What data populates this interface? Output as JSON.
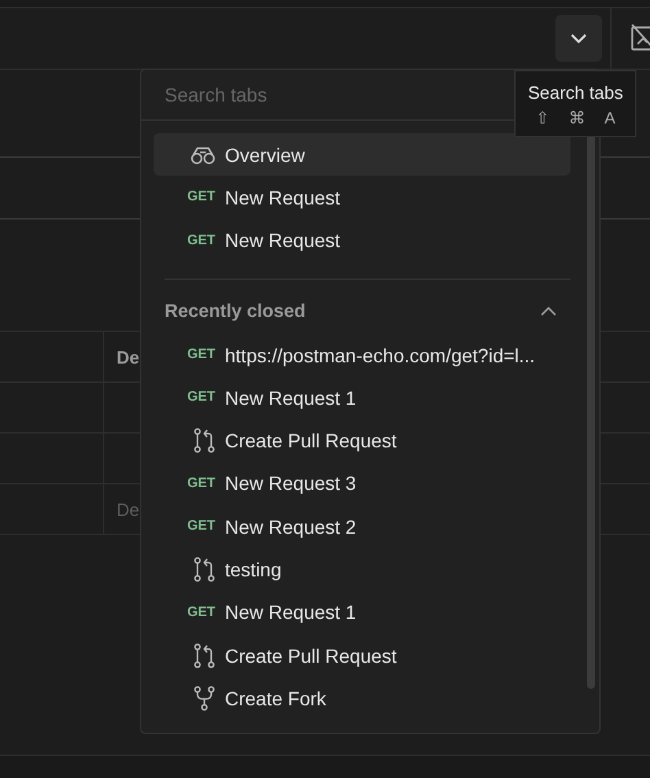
{
  "table": {
    "header": "De",
    "rows": [
      {},
      {},
      {
        "cell": "De"
      }
    ]
  },
  "tab_menu": {
    "search": {
      "placeholder": "Search tabs"
    },
    "open_tabs": [
      {
        "kind": "overview",
        "label": "Overview",
        "selected": true
      },
      {
        "kind": "request",
        "method": "GET",
        "label": "New Request",
        "selected": false
      },
      {
        "kind": "request",
        "method": "GET",
        "label": "New Request",
        "selected": false
      }
    ],
    "recently_closed": {
      "title": "Recently closed",
      "expanded": true,
      "items": [
        {
          "kind": "request",
          "method": "GET",
          "label": "https://postman-echo.com/get?id=l...",
          "selected": false
        },
        {
          "kind": "request",
          "method": "GET",
          "label": "New Request 1",
          "selected": false
        },
        {
          "kind": "pull_request",
          "label": "Create Pull Request",
          "selected": false
        },
        {
          "kind": "request",
          "method": "GET",
          "label": "New Request 3",
          "selected": false
        },
        {
          "kind": "request",
          "method": "GET",
          "label": "New Request 2",
          "selected": false
        },
        {
          "kind": "pull_request",
          "label": "testing",
          "selected": false
        },
        {
          "kind": "request",
          "method": "GET",
          "label": "New Request 1",
          "selected": false
        },
        {
          "kind": "pull_request",
          "label": "Create Pull Request",
          "selected": false
        },
        {
          "kind": "fork",
          "label": "Create Fork",
          "selected": false
        }
      ]
    }
  },
  "tooltip": {
    "title": "Search tabs",
    "keys": [
      "⇧",
      "⌘",
      "A"
    ]
  }
}
